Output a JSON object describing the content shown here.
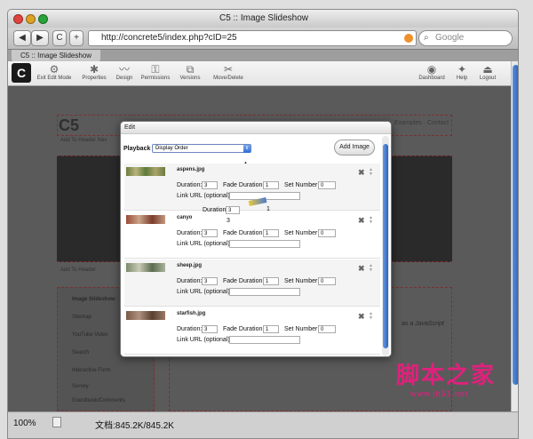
{
  "window": {
    "title": "C5 :: Image Slideshow"
  },
  "browser": {
    "url": "http://concrete5/index.php?cID=25",
    "search_placeholder": "Google",
    "tab_label": "C5 :: Image Slideshow",
    "nav": {
      "back": "◀",
      "forward": "▶",
      "reload": "C",
      "add": "+"
    }
  },
  "c5toolbar": {
    "logo": "C",
    "left": [
      "Exit Edit Mode",
      "Properties",
      "Design",
      "Permissions",
      "Versions",
      "Move/Delete"
    ],
    "right": [
      "Dashboard",
      "Help",
      "Logout"
    ]
  },
  "background": {
    "site_title": "C5",
    "nav_links": [
      "Examples",
      "Contact"
    ],
    "add_to_header_nav": "Add To Header Nav",
    "add_to_header": "Add To Header",
    "sidebar_items": [
      "Image Slideshow",
      "Sitemap",
      "YouTube Video",
      "Search",
      "Interactive Form",
      "Survey",
      "Guestbook/Comments"
    ],
    "js_text": "as a JavaScript"
  },
  "modal": {
    "title": "Edit",
    "playback_label": "Playback",
    "playback_value": "Display Order",
    "add_image": "Add Image",
    "labels": {
      "duration": "Duration:",
      "fade": "Fade Duration:",
      "set": "Set Number:",
      "link": "Link URL (optional):"
    },
    "images": [
      {
        "file": "aspens.jpg",
        "duration": "3",
        "fade": "1",
        "set": "0"
      },
      {
        "file": "canyo",
        "duration": "3",
        "fade": "1",
        "set": "0"
      },
      {
        "file": "sheep.jpg",
        "duration": "3",
        "fade": "1",
        "set": "0"
      },
      {
        "file": "starfish.jpg",
        "duration": "3",
        "fade": "1",
        "set": "0"
      }
    ],
    "drag_ghost": {
      "label": "Duration:",
      "duration": "3",
      "fade": "1",
      "extra": "3"
    }
  },
  "status": {
    "zoom": "100%",
    "info": "文档:845.2K/845.2K"
  },
  "watermark": {
    "text": "脚本之家",
    "url": "www.jb51.net"
  },
  "colors": {
    "accent": "#2a63c0",
    "watermark": "#e0217c"
  }
}
